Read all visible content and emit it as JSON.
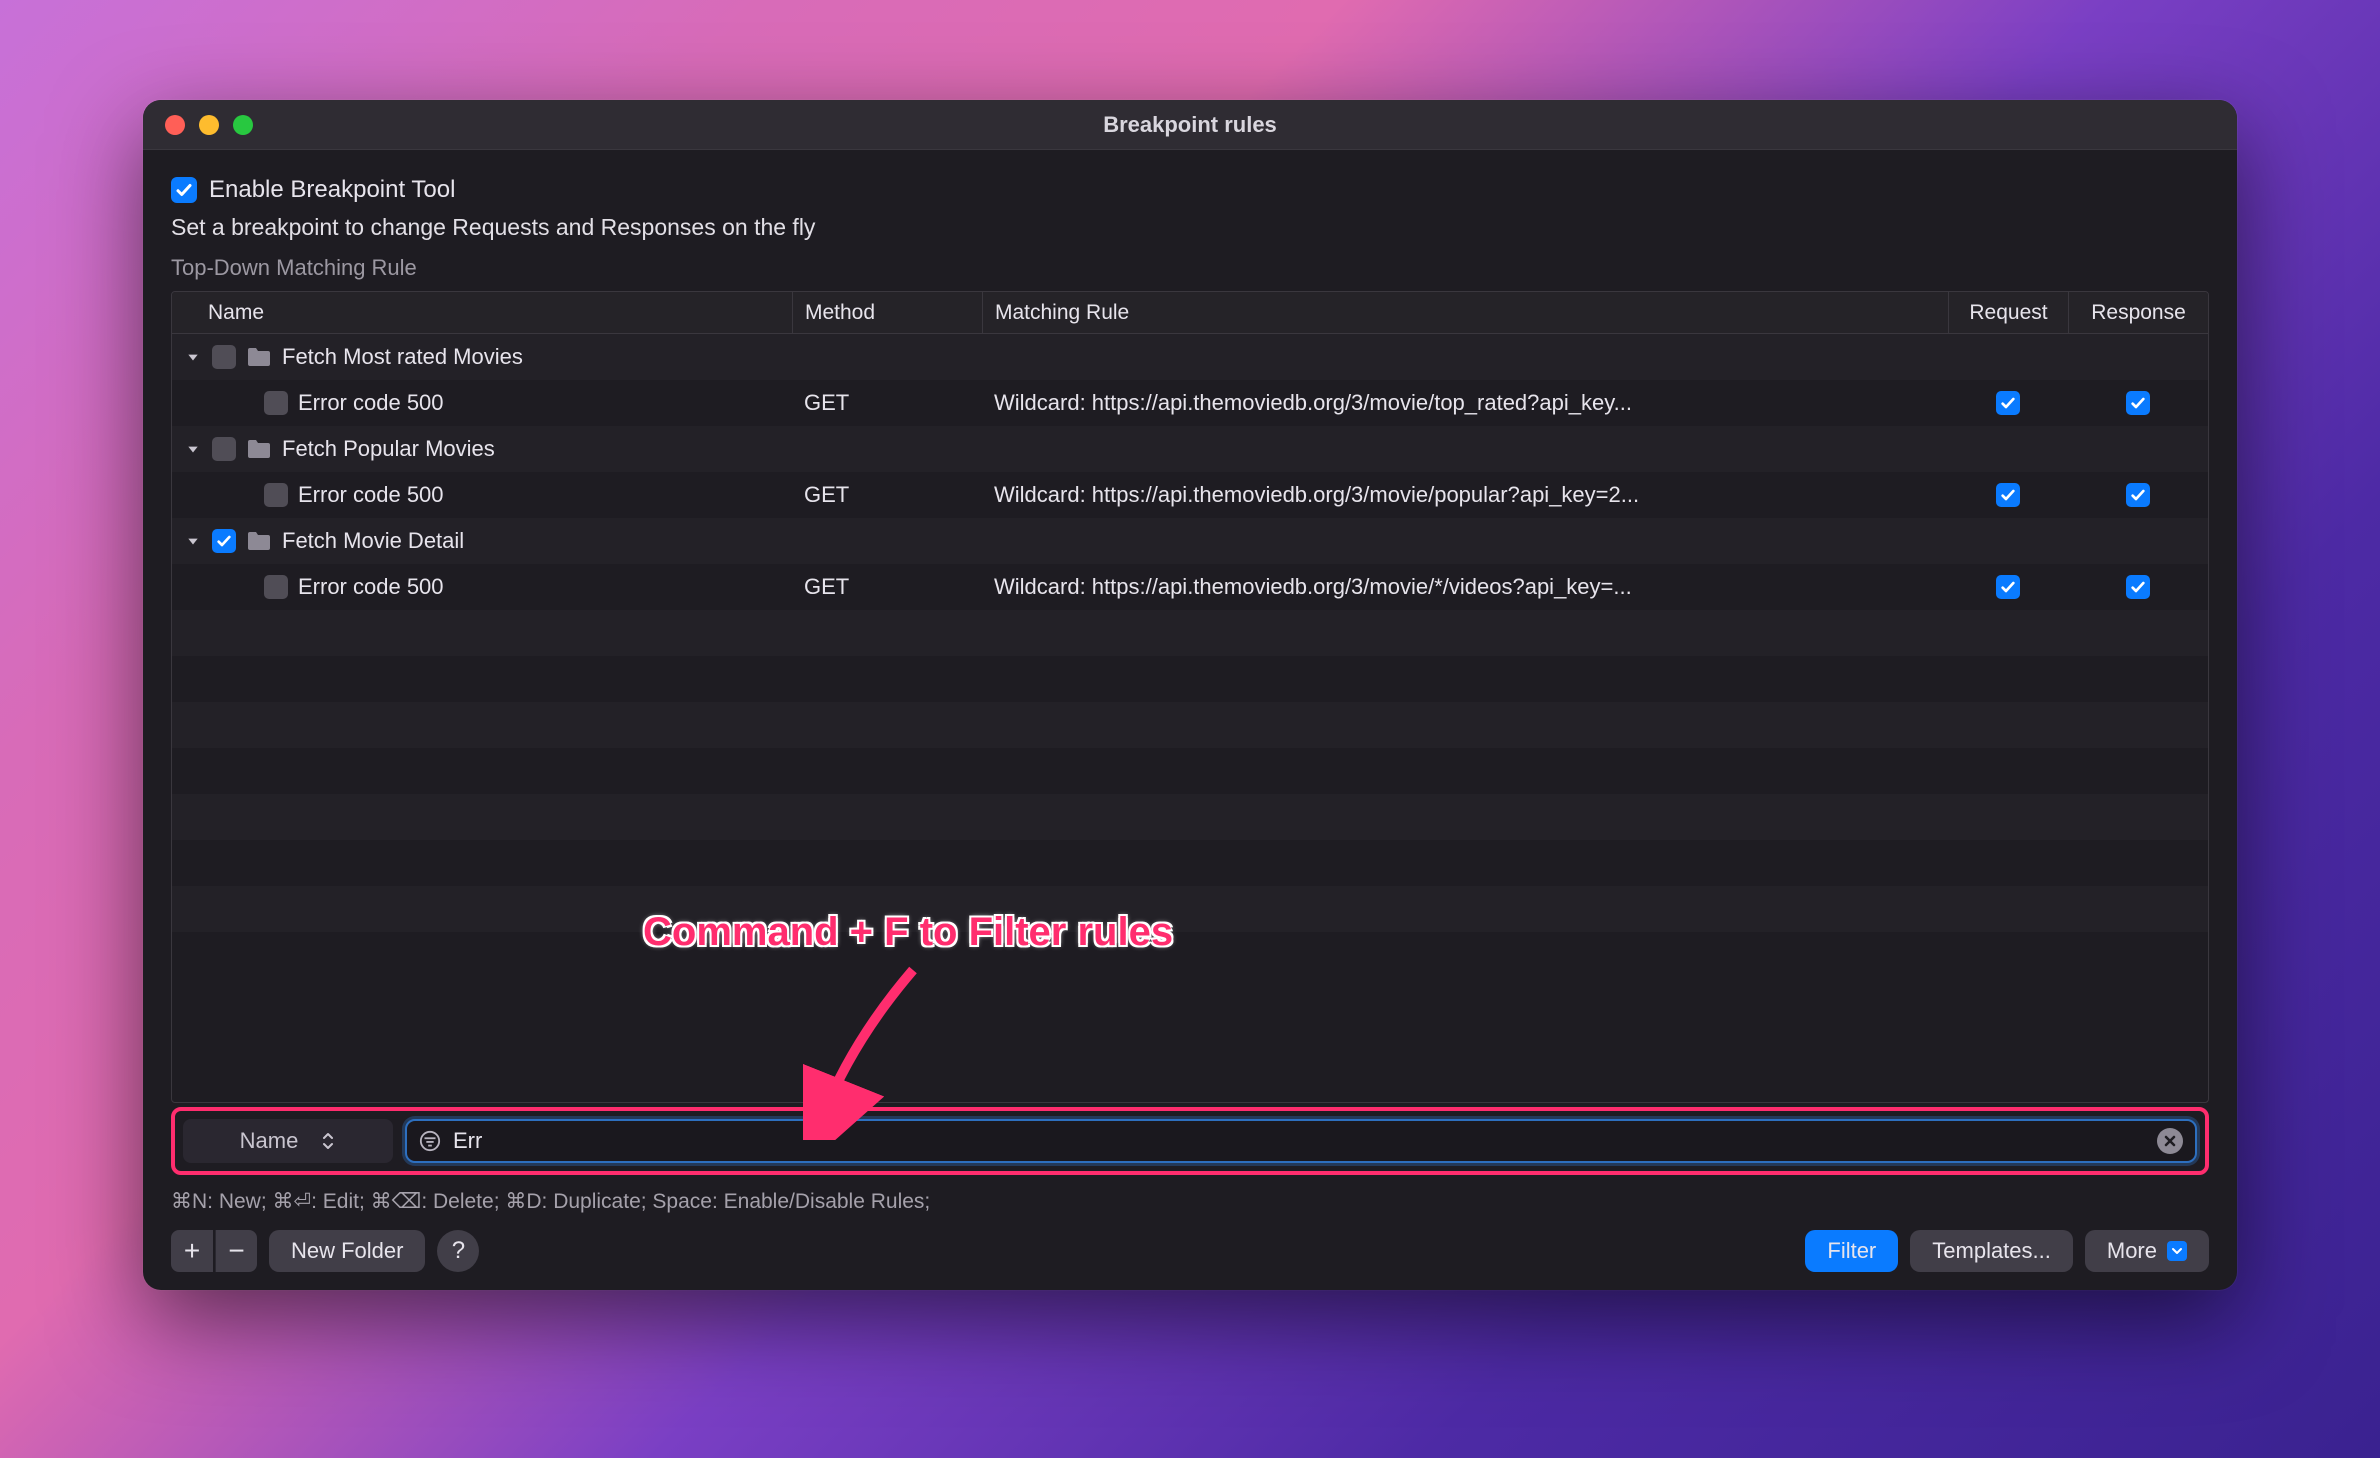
{
  "window": {
    "title": "Breakpoint rules"
  },
  "enable": {
    "label": "Enable Breakpoint Tool",
    "checked": true
  },
  "subtitle": "Set a breakpoint to change Requests and Responses on the fly",
  "subheader": "Top-Down Matching Rule",
  "columns": {
    "name": "Name",
    "method": "Method",
    "rule": "Matching Rule",
    "request": "Request",
    "response": "Response"
  },
  "rows": [
    {
      "type": "group",
      "label": "Fetch Most rated Movies",
      "checked": false,
      "expanded": true
    },
    {
      "type": "item",
      "label": "Error code 500",
      "checked": false,
      "method": "GET",
      "rule": "Wildcard: https://api.themoviedb.org/3/movie/top_rated?api_key...",
      "request": true,
      "response": true
    },
    {
      "type": "group",
      "label": "Fetch Popular Movies",
      "checked": false,
      "expanded": true
    },
    {
      "type": "item",
      "label": "Error code 500",
      "checked": false,
      "method": "GET",
      "rule": "Wildcard: https://api.themoviedb.org/3/movie/popular?api_key=2...",
      "request": true,
      "response": true
    },
    {
      "type": "group",
      "label": "Fetch Movie Detail",
      "checked": true,
      "expanded": true
    },
    {
      "type": "item",
      "label": "Error code 500",
      "checked": false,
      "method": "GET",
      "rule": "Wildcard: https://api.themoviedb.org/3/movie/*/videos?api_key=...",
      "request": true,
      "response": true
    }
  ],
  "filter": {
    "selector": "Name",
    "value": "Err"
  },
  "shortcuts": "⌘N: New; ⌘⏎: Edit; ⌘⌫: Delete; ⌘D: Duplicate; Space: Enable/Disable Rules;",
  "buttons": {
    "newFolder": "New Folder",
    "filter": "Filter",
    "templates": "Templates...",
    "more": "More"
  },
  "annotation": "Command + F to Filter rules"
}
